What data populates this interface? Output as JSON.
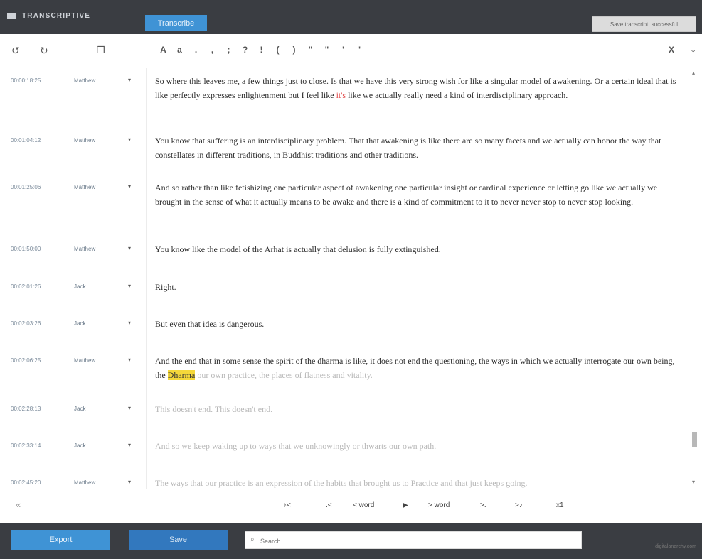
{
  "app": {
    "brand": "TRANSCRIPTIVE",
    "transcribe_label": "Transcribe",
    "status_text": "Save transcript: successful"
  },
  "toolbar": {
    "undo_icon": "undo-icon",
    "redo_icon": "redo-icon",
    "speaker_icon": "speakers-icon",
    "format_buttons": [
      "A",
      "a",
      ".",
      ",",
      ";",
      "?",
      "!",
      "(",
      ")",
      "\"",
      "\"",
      "'",
      "'"
    ],
    "close_label": "X",
    "download_icon": "download-icon"
  },
  "rows": [
    {
      "timestamp": "00:00:18:25",
      "speaker": "Matthew",
      "text_before": "So where this leaves me, a few things just to close. Is that we have this very strong wish for like a singular model of awakening. Or a certain ideal that is like perfectly expresses enlightenment but I feel like ",
      "text_highlight": "it's",
      "text_after": " like we actually really need a kind of interdisciplinary approach."
    },
    {
      "timestamp": "00:01:04:12",
      "speaker": "Matthew",
      "text": "You know that suffering is an interdisciplinary problem. That that awakening is like there are so many facets and we actually can honor the way that constellates in different traditions, in Buddhist traditions and other traditions."
    },
    {
      "timestamp": "00:01:25:06",
      "speaker": "Matthew",
      "text": "And so rather than like fetishizing one particular aspect of awakening one particular insight or cardinal experience or letting go like we actually we brought in the sense of what it actually means to be awake and there is a kind of commitment to it to never never stop to never stop looking."
    },
    {
      "timestamp": "00:01:50:00",
      "speaker": "Matthew",
      "text": "You know like the model of the Arhat is actually that delusion is fully extinguished."
    },
    {
      "timestamp": "00:02:01:26",
      "speaker": "Jack",
      "text": "Right."
    },
    {
      "timestamp": "00:02:03:26",
      "speaker": "Jack",
      "text": "But even that idea is dangerous."
    },
    {
      "timestamp": "00:02:06:25",
      "speaker": "Matthew",
      "text_before": "And the end that in some sense the spirit of the dharma is like, it does not end the questioning, the ways in which we actually interrogate our own being, the ",
      "text_highlight": "Dharma",
      "text_faded": " our own practice, the places of flatness and vitality."
    },
    {
      "timestamp": "00:02:28:13",
      "speaker": "Jack",
      "text": "This doesn't end. This doesn't end."
    },
    {
      "timestamp": "00:02:33:14",
      "speaker": "Jack",
      "text": "And so we keep waking up to ways that we unknowingly or thwarts our own path."
    },
    {
      "timestamp": "00:02:45:20",
      "speaker": "Matthew",
      "text": "The ways that our practice is an expression of the habits that brought us to Practice and that just keeps going."
    }
  ],
  "playback": {
    "prev_speaker": "♪<",
    "prev_sentence": ".<",
    "prev_word": "< word",
    "play": "▶",
    "next_word": "> word",
    "next_sentence": ">.",
    "next_speaker": ">♪",
    "speed": "x1"
  },
  "bottom": {
    "export_label": "Export",
    "save_label": "Save",
    "search_placeholder": "Search",
    "footer_note": "digitalanarchy.com"
  },
  "colors": {
    "topbar": "#3a3d42",
    "accent": "#3f93d5",
    "save": "#3278be",
    "highlight_yellow": "#f5d83a",
    "highlight_red": "#e24c4c"
  }
}
